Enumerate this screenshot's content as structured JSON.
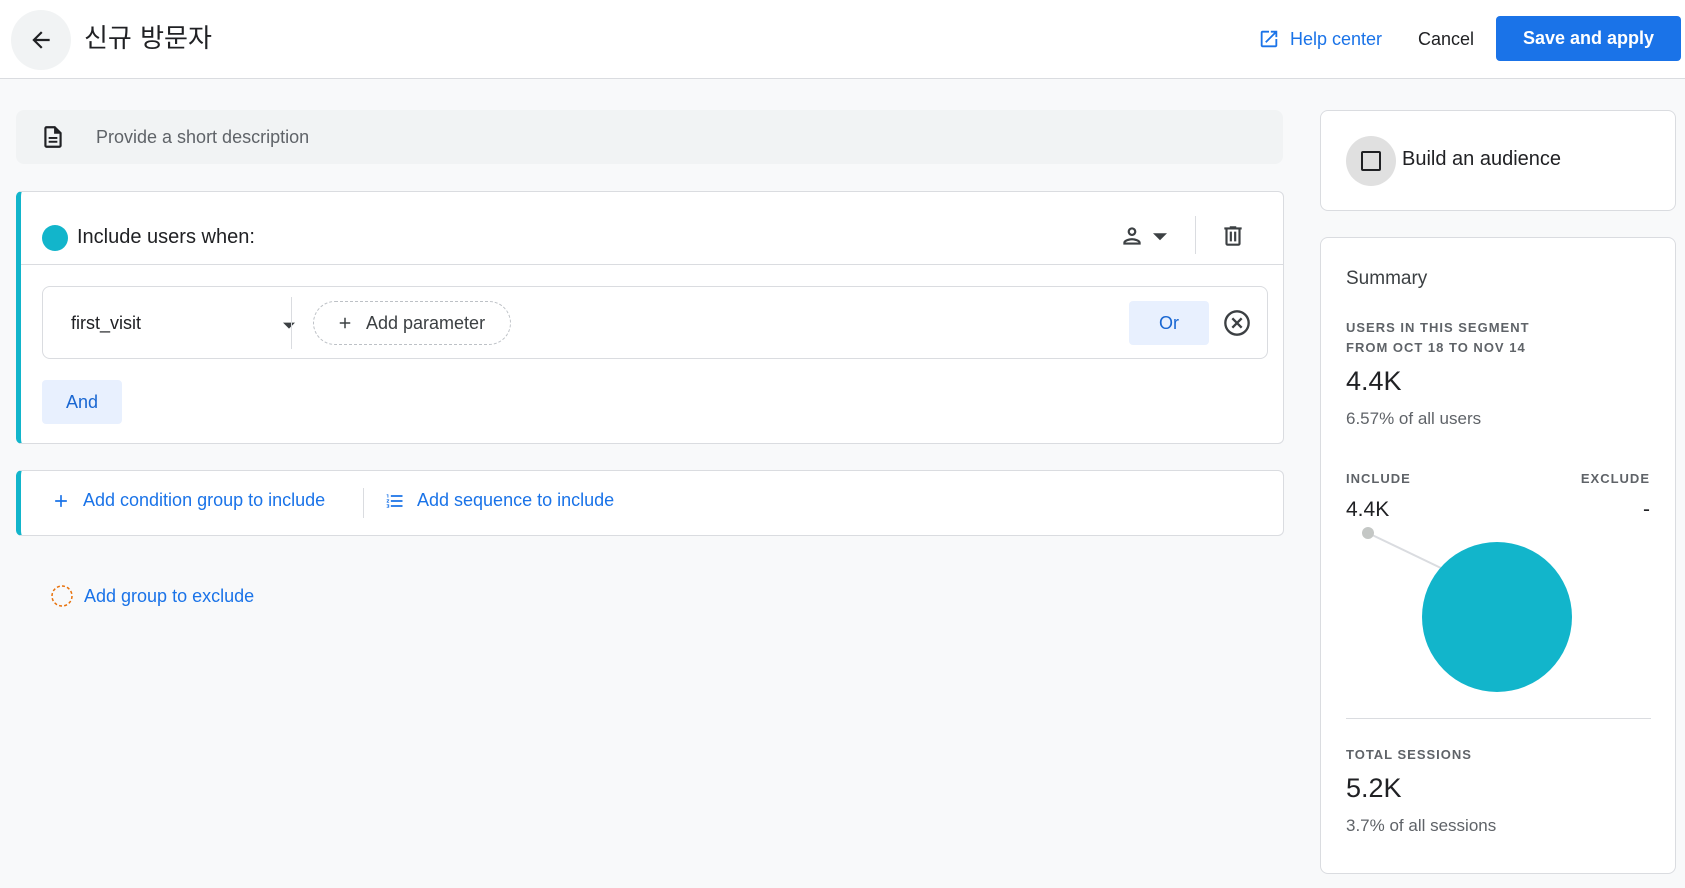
{
  "header": {
    "back_icon": "arrow-back-icon",
    "title": "신규 방문자",
    "help_label": "Help center",
    "help_icon": "open-in-new-icon",
    "cancel_label": "Cancel",
    "save_label": "Save and apply"
  },
  "description": {
    "icon": "document-icon",
    "placeholder": "Provide a short description",
    "value": ""
  },
  "include_group": {
    "title": "Include users when:",
    "scope_icon": "person-icon",
    "condition": {
      "event": "first_visit",
      "add_parameter_label": "Add parameter",
      "or_label": "Or"
    },
    "and_label": "And"
  },
  "add_group": {
    "add_condition_label": "Add condition group to include",
    "add_sequence_label": "Add sequence to include",
    "add_exclude_label": "Add group to exclude"
  },
  "audience": {
    "label": "Build an audience",
    "checked": false
  },
  "summary": {
    "title": "Summary",
    "segment_label_line1": "USERS IN THIS SEGMENT",
    "segment_label_line2": "FROM OCT 18 TO NOV 14",
    "segment_value": "4.4K",
    "segment_sub": "6.57% of all users",
    "include_label": "INCLUDE",
    "include_value": "4.4K",
    "exclude_label": "EXCLUDE",
    "exclude_value": "-",
    "sessions_label": "TOTAL SESSIONS",
    "sessions_value": "5.2K",
    "sessions_sub": "3.7% of all sessions"
  },
  "colors": {
    "accent": "#1a73e8",
    "include_teal": "#12b5cb",
    "exclude_orange": "#e8710a",
    "chip_bg": "#e8f0fe"
  }
}
